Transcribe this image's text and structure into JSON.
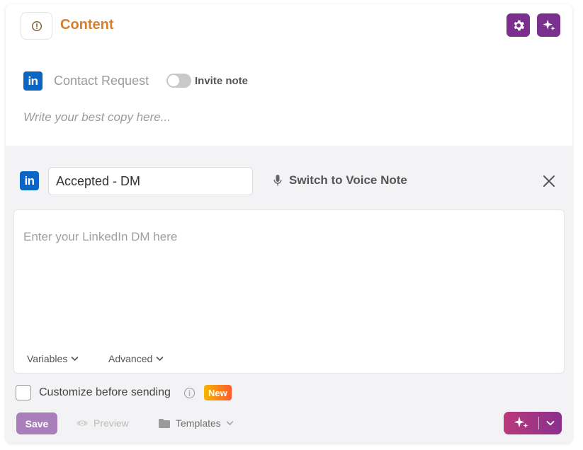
{
  "header": {
    "title": "Content",
    "icon": "alert-circle-icon",
    "settings_icon": "gear-icon",
    "magic_icon": "sparkles-icon",
    "accent_color": "#d2802f",
    "button_color": "#7b2f8e"
  },
  "contact_request": {
    "logo_text": "in",
    "label": "Contact Request",
    "toggle_label": "Invite note",
    "toggle_on": false,
    "copy_placeholder": "Write your best copy here..."
  },
  "step": {
    "logo_text": "in",
    "name_value": "Accepted - DM",
    "voice_link": "Switch to Voice Note",
    "voice_icon": "microphone-icon",
    "close_icon": "close-icon",
    "dm_placeholder": "Enter your LinkedIn DM here",
    "variables_label": "Variables",
    "advanced_label": "Advanced"
  },
  "footer": {
    "customize_label": "Customize before sending",
    "new_badge": "New",
    "save_label": "Save",
    "preview_label": "Preview",
    "templates_label": "Templates"
  },
  "brand_colors": {
    "linkedin": "#0a66c2"
  }
}
